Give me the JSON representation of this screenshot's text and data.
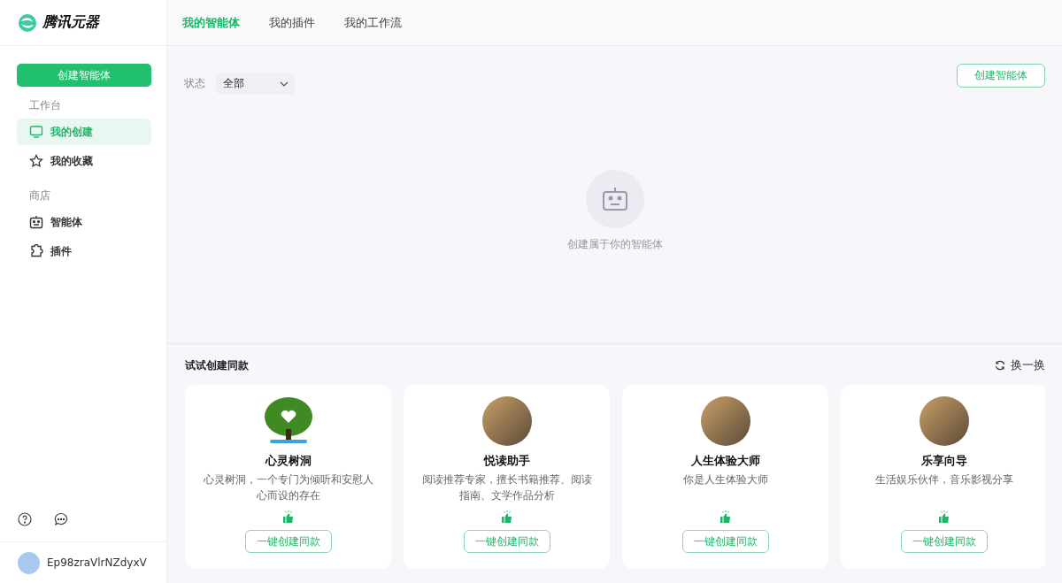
{
  "logo": {
    "text": "腾讯元器"
  },
  "sidebar": {
    "create_button": "创建智能体",
    "sections": [
      {
        "title": "工作台",
        "items": [
          {
            "label": "我的创建",
            "kind": "monitor",
            "selected": true
          },
          {
            "label": "我的收藏",
            "kind": "star",
            "selected": false
          }
        ]
      },
      {
        "title": "商店",
        "items": [
          {
            "label": "智能体",
            "kind": "robot",
            "selected": false
          },
          {
            "label": "插件",
            "kind": "puzzle",
            "selected": false
          }
        ]
      }
    ],
    "user": {
      "name": "Ep98zraVlrNZdyxV"
    }
  },
  "tabs": [
    {
      "label": "我的智能体",
      "selected": true
    },
    {
      "label": "我的插件",
      "selected": false
    },
    {
      "label": "我的工作流",
      "selected": false
    }
  ],
  "filter": {
    "label": "状态",
    "value": "全部"
  },
  "create_button": "创建智能体",
  "empty_state": {
    "text": "创建属于你的智能体"
  },
  "suggestions": {
    "title": "试试创建同款",
    "refresh": "换一换",
    "cards": [
      {
        "name": "心灵树洞",
        "description": "心灵树洞，一个专门为倾听和安慰人心而设的存在",
        "button": "一键创建同款",
        "kind": "tree"
      },
      {
        "name": "悦读助手",
        "description": "阅读推荐专家，擅长书籍推荐、阅读指南、文学作品分析",
        "button": "一键创建同款",
        "kind": "photo"
      },
      {
        "name": "人生体验大师",
        "description": "你是人生体验大师",
        "button": "一键创建同款",
        "kind": "photo"
      },
      {
        "name": "乐享向导",
        "description": "生活娱乐伙伴，音乐影视分享",
        "button": "一键创建同款",
        "kind": "photo"
      }
    ]
  }
}
